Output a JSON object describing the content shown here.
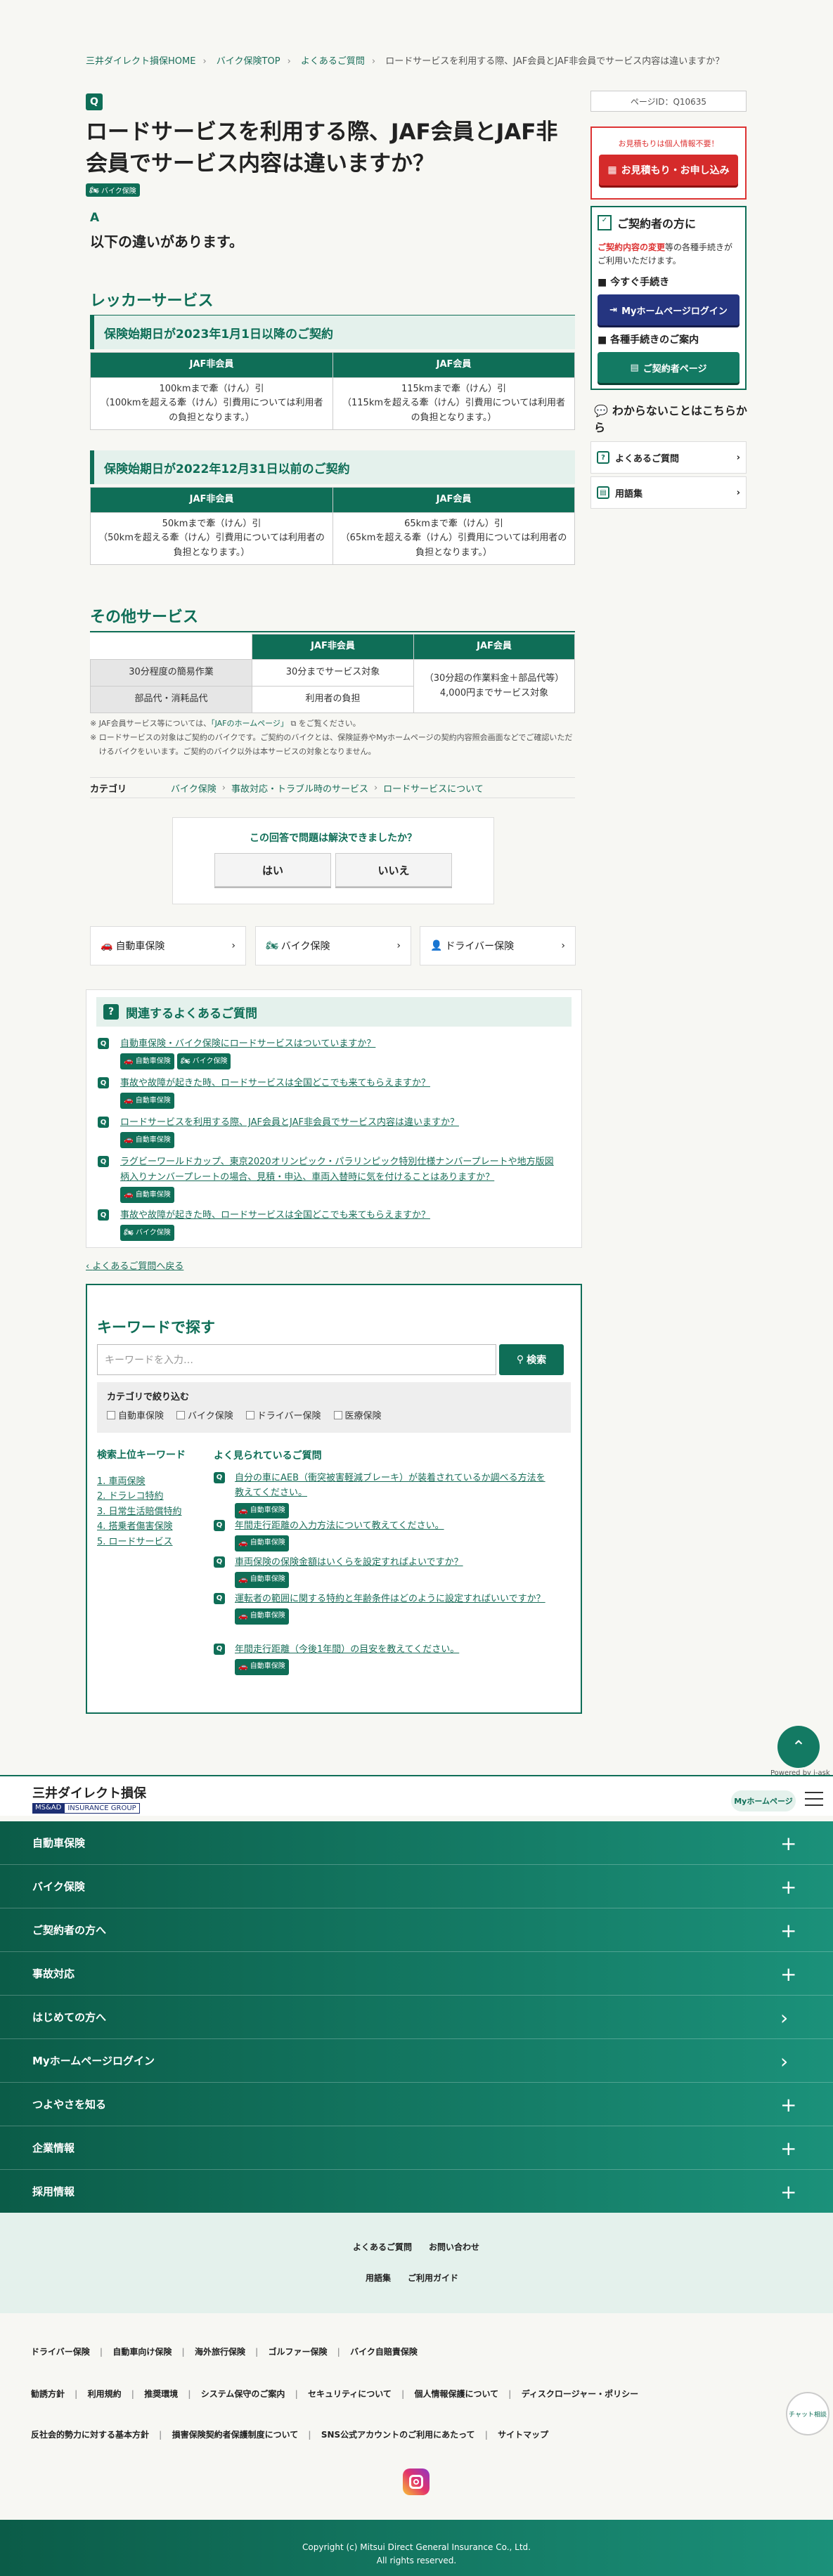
{
  "breadcrumb": [
    "三井ダイレクト損保HOME",
    "バイク保険TOP",
    "よくあるご質問",
    "ロードサービスを利用する際、JAF会員とJAF非会員でサービス内容は違いますか？"
  ],
  "question": {
    "mark": "Q",
    "title": "ロードサービスを利用する際、JAF会員とJAF非会員でサービス内容は違いますか？",
    "tag": "バイク保険"
  },
  "page_id": "ページID：Q10635",
  "sidebar": {
    "est_note": "お見積もりは個人情報不要！",
    "est_button": "お見積もり・お申し込み",
    "cust_title": "ご契約者の方に",
    "cust_desc_red": "ご契約内容の変更",
    "cust_desc": "等の各種手続きがご利用いただけます。",
    "sub1": "今すぐ手続き",
    "mypage_button": "Myホームページログイン",
    "sub2": "各種手続きのご案内",
    "cust_page_button": "ご契約者ページ",
    "help_title": "わからないことはこちらから",
    "faq": "よくあるご質問",
    "glossary": "用語集"
  },
  "answer": {
    "mark": "A",
    "text": "以下の違いがあります。"
  },
  "wrecker": {
    "heading": "レッカーサービス",
    "period1": "保険始期日が2023年1月1日以降のご契約",
    "period2": "保険始期日が2022年12月31日以前のご契約",
    "col_nonmember": "JAF非会員",
    "col_member": "JAF会員",
    "t1_nonmember_1": "100kmまで牽（けん）引",
    "t1_nonmember_2": "（100kmを超える牽（けん）引費用については利用者の負担となります。）",
    "t1_member_1": "115kmまで牽（けん）引",
    "t1_member_2": "（115kmを超える牽（けん）引費用については利用者の負担となります。）",
    "t2_nonmember_1": "50kmまで牽（けん）引",
    "t2_nonmember_2": "（50kmを超える牽（けん）引費用については利用者の負担となります。）",
    "t2_member_1": "65kmまで牽（けん）引",
    "t2_member_2": "（65kmを超える牽（けん）引費用については利用者の負担となります。）"
  },
  "other": {
    "heading": "その他サービス",
    "row1_label": "30分程度の簡易作業",
    "row1_nonmember": "30分までサービス対象",
    "row2_label": "部品代・消耗品代",
    "row2_nonmember": "利用者の負担",
    "member_merged_1": "（30分超の作業料金＋部品代等）",
    "member_merged_2": "4,000円までサービス対象"
  },
  "notes": {
    "n1a": "JAF会員サービス等については、",
    "n1link": "「JAFのホームページ」",
    "n1b": "をご覧ください。",
    "n2": "ロードサービスの対象はご契約のバイクです。ご契約のバイクとは、保険証券やMyホームページの契約内容照会画面などでご確認いただけるバイクをいいます。ご契約のバイク以外は本サービスの対象となりません。"
  },
  "category": {
    "label": "カテゴリ",
    "items": [
      "バイク保険",
      "事故対応・トラブル時のサービス",
      "ロードサービスについて"
    ]
  },
  "survey": {
    "question": "この回答で問題は解決できましたか？",
    "yes": "はい",
    "no": "いいえ"
  },
  "products": [
    "自動車保険",
    "バイク保険",
    "ドライバー保険"
  ],
  "related": {
    "heading": "関連するよくあるご質問",
    "items": [
      {
        "q": "自動車保険・バイク保険にロードサービスはついていますか？",
        "tags": [
          "自動車保険",
          "バイク保険"
        ]
      },
      {
        "q": "事故や故障が起きた時、ロードサービスは全国どこでも来てもらえますか？",
        "tags": [
          "自動車保険"
        ]
      },
      {
        "q": "ロードサービスを利用する際、JAF会員とJAF非会員でサービス内容は違いますか？",
        "tags": [
          "自動車保険"
        ]
      },
      {
        "q": "ラグビーワールドカップ、東京2020オリンピック・パラリンピック特別仕様ナンバープレートや地方版図柄入りナンバープレートの場合、見積・申込、車両入替時に気を付けることはありますか？",
        "tags": [
          "自動車保険"
        ]
      },
      {
        "q": "事故や故障が起きた時、ロードサービスは全国どこでも来てもらえますか？",
        "tags": [
          "バイク保険"
        ]
      }
    ]
  },
  "back_link": "よくあるご質問へ戻る",
  "keyword": {
    "heading": "キーワードで探す",
    "placeholder": "キーワードを入力…",
    "search_button": "検索",
    "filter_title": "カテゴリで絞り込む",
    "filters": [
      "自動車保険",
      "バイク保険",
      "ドライバー保険",
      "医療保険"
    ],
    "ranking_title": "検索上位キーワード",
    "ranking": [
      "1. 車両保険",
      "2. ドラレコ特約",
      "3. 日常生活賠償特約",
      "4. 搭乗者傷害保険",
      "5. ロードサービス"
    ],
    "popular_title": "よく見られているご質問",
    "popular": [
      {
        "q": "自分の車にAEB（衝突被害軽減ブレーキ）が装着されているか調べる方法を教えてください。",
        "tag": "自動車保険"
      },
      {
        "q": "年間走行距離の入力方法について教えてください。",
        "tag": "自動車保険"
      },
      {
        "q": "車両保険の保険金額はいくらを設定すればよいですか？",
        "tag": "自動車保険"
      },
      {
        "q": "運転者の範囲に関する特約と年齢条件はどのように設定すればいいですか？",
        "tag": "自動車保険"
      },
      {
        "q": "年間走行距離（今後1年間）の目安を教えてください。",
        "tag": "自動車保険"
      }
    ]
  },
  "powered": "Powered by i-ask",
  "footer": {
    "logo": "三井ダイレクト損保",
    "group_ms": "MS&AD",
    "group_ig": "INSURANCE GROUP",
    "mypage": "Myホームページ",
    "accordion": [
      {
        "label": "自動車保険",
        "sym": "+"
      },
      {
        "label": "バイク保険",
        "sym": "+"
      },
      {
        "label": "ご契約者の方へ",
        "sym": "+"
      },
      {
        "label": "事故対応",
        "sym": "+"
      },
      {
        "label": "はじめての方へ",
        "sym": "›"
      },
      {
        "label": "Myホームページログイン",
        "sym": "›"
      },
      {
        "label": "つよやさを知る",
        "sym": "+"
      },
      {
        "label": "企業情報",
        "sym": "+"
      },
      {
        "label": "採用情報",
        "sym": "+"
      }
    ],
    "links1": [
      "よくあるご質問",
      "お問い合わせ"
    ],
    "links2": [
      "用語集",
      "ご利用ガイド"
    ],
    "row1": [
      "ドライバー保険",
      "自動車向け保険",
      "海外旅行保険",
      "ゴルファー保険",
      "バイク自賠責保険"
    ],
    "row2": [
      "勧誘方針",
      "利用規約",
      "推奨環境",
      "システム保守のご案内",
      "セキュリティについて",
      "個人情報保護について",
      "ディスクロージャー・ポリシー"
    ],
    "row3": [
      "反社会的勢力に対する基本方針",
      "損害保険契約者保護制度について",
      "SNS公式アカウントのご利用にあたって",
      "サイトマップ"
    ],
    "copyright1": "Copyright (c) Mitsui Direct General Insurance Co., Ltd.",
    "copyright2": "All rights reserved.",
    "avatar_label": "チャット相談"
  }
}
